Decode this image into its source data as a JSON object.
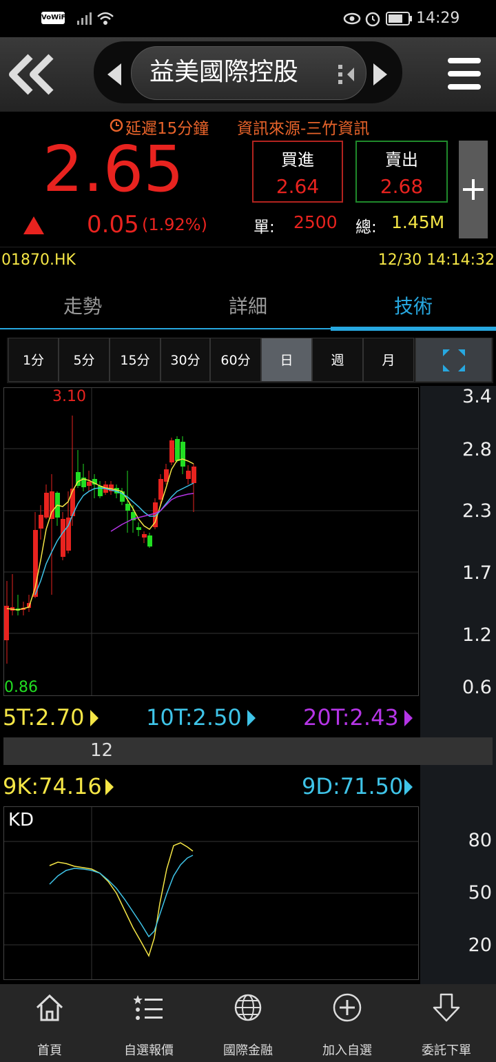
{
  "status_bar": {
    "wifi_label": "VoWiFi",
    "time": "14:29"
  },
  "header": {
    "stock_name": "益美國際控股"
  },
  "quote": {
    "delay_notice": "延遲15分鐘",
    "source": "資訊來源-三竹資訊",
    "price": "2.65",
    "change": "0.05",
    "change_pct": "(1.92%)",
    "bid_label": "買進",
    "bid": "2.64",
    "ask_label": "賣出",
    "ask": "2.68",
    "unit_label": "單:",
    "unit_volume": "2500",
    "total_label": "總:",
    "total_volume": "1.45M"
  },
  "code_row": {
    "code": "01870.HK",
    "datetime": "12/30 14:14:32"
  },
  "tabs": [
    {
      "label": "走勢",
      "active": false
    },
    {
      "label": "詳細",
      "active": false
    },
    {
      "label": "技術",
      "active": true
    }
  ],
  "periods": [
    "1分",
    "5分",
    "15分",
    "30分",
    "60分",
    "日",
    "週",
    "月"
  ],
  "selected_period": "日",
  "candle_chart": {
    "high_label": "3.10",
    "low_label": "0.86",
    "y_axis": [
      "3.4",
      "2.8",
      "2.3",
      "1.7",
      "1.2",
      "0.6"
    ],
    "ma": [
      {
        "label": "5T:2.70",
        "color": "#f5e646"
      },
      {
        "label": "10T:2.50",
        "color": "#3fc4e8"
      },
      {
        "label": "20T:2.43",
        "color": "#b535e6"
      }
    ],
    "vertical_marker": "12"
  },
  "kd_chart": {
    "k_label": "9K:74.16",
    "d_label": "9D:71.50",
    "title": "KD",
    "y_axis": [
      "80",
      "50",
      "20"
    ]
  },
  "bottom_nav": [
    "首頁",
    "自選報價",
    "國際金融",
    "加入自選",
    "委託下單"
  ],
  "colors": {
    "up": "#e8231f",
    "down": "#22dd22",
    "accent": "#27a8e0",
    "yellow": "#f5e646"
  }
}
